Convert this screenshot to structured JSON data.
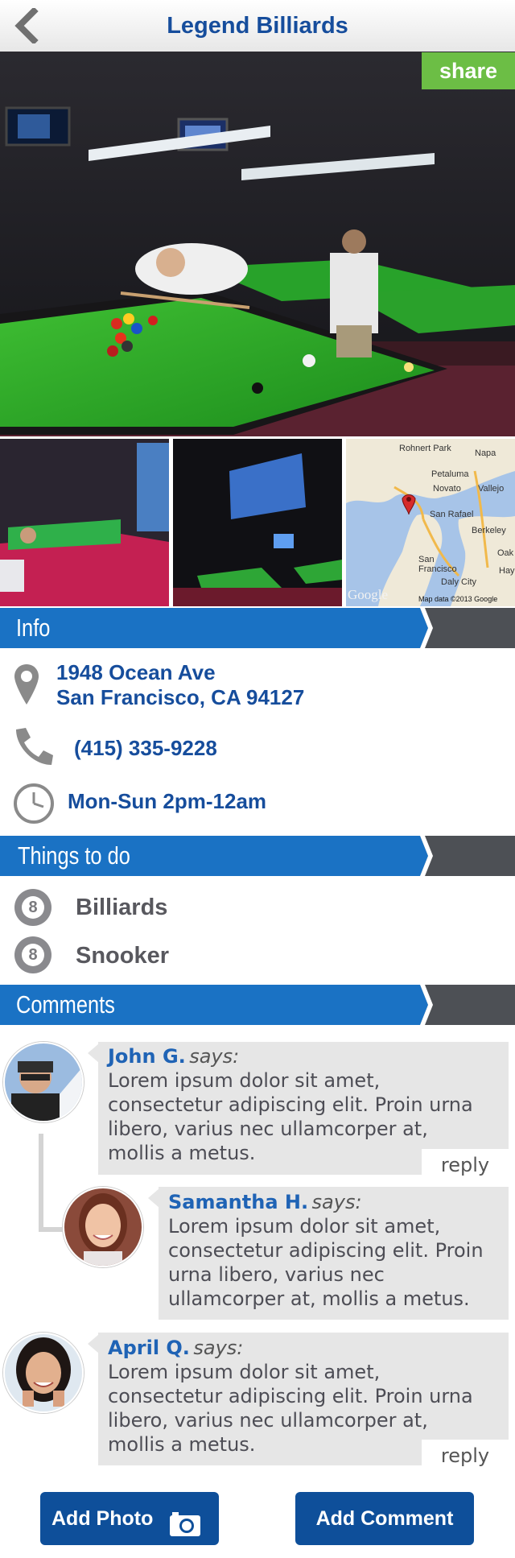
{
  "header": {
    "title": "Legend Billiards"
  },
  "share_label": "share",
  "map": {
    "labels": [
      "Rohnert Park",
      "Napa",
      "Petaluma",
      "Novato",
      "Vallejo",
      "San Rafael",
      "Berkeley",
      "Oak",
      "San Francisco",
      "Hay",
      "Daly City"
    ],
    "attribution": "Map data ©2013 Google",
    "logo": "Google"
  },
  "info": {
    "section_title": "Info",
    "address_line1": "1948 Ocean Ave",
    "address_line2": "San Francisco, CA 94127",
    "phone": "(415) 335-9228",
    "hours": "Mon-Sun 2pm-12am"
  },
  "things": {
    "section_title": "Things to do",
    "items": [
      {
        "icon_text": "8",
        "label": "Billiards"
      },
      {
        "icon_text": "8",
        "label": "Snooker"
      }
    ]
  },
  "comments": {
    "section_title": "Comments",
    "says": "says:",
    "reply_label": "reply",
    "items": [
      {
        "name": "John G.",
        "lines": [
          "Lorem ipsum dolor sit amet,",
          "consectetur adipiscing elit. Proin urna",
          "libero, varius nec ullamcorper at,",
          "mollis a metus."
        ]
      },
      {
        "name": "Samantha H.",
        "lines": [
          "Lorem ipsum dolor sit amet,",
          "consectetur adipiscing elit. Proin",
          "urna libero, varius nec",
          "ullamcorper at, mollis a metus."
        ]
      },
      {
        "name": "April Q.",
        "lines": [
          "Lorem ipsum dolor sit amet,",
          "consectetur adipiscing elit. Proin urna",
          "libero, varius nec ullamcorper at,",
          "mollis a metus."
        ]
      }
    ]
  },
  "actions": {
    "add_photo": "Add Photo",
    "add_comment": "Add Comment"
  },
  "colors": {
    "accent_blue": "#164d9c",
    "bar_blue": "#1a72c4",
    "share_green": "#6cbe45",
    "button_blue": "#0e4f9a"
  },
  "icons": [
    "back-chevron-icon",
    "location-pin-icon",
    "phone-icon",
    "clock-icon",
    "eight-ball-icon",
    "camera-icon"
  ]
}
